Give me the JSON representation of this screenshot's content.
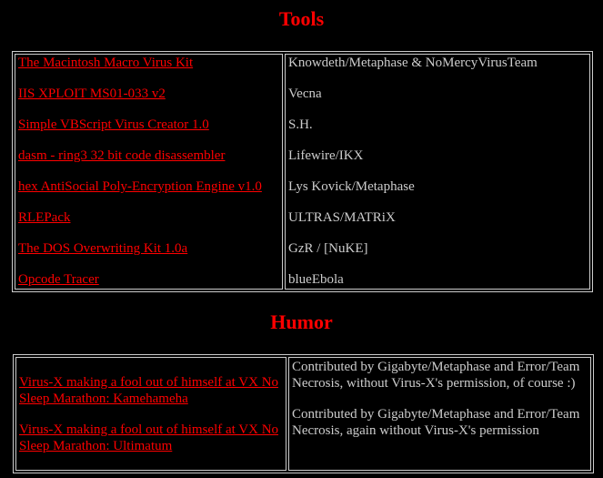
{
  "colors": {
    "background": "#000000",
    "heading": "#ff0000",
    "link": "#ff0000",
    "text": "#cccccc",
    "border": "#cccccc"
  },
  "tools": {
    "heading": "Tools",
    "rows": [
      {
        "name": "The Macintosh Macro Virus Kit",
        "author": "Knowdeth/Metaphase & NoMercyVirusTeam"
      },
      {
        "name": "IIS XPLOIT MS01-033 v2",
        "author": "Vecna"
      },
      {
        "name": "Simple VBScript Virus Creator 1.0",
        "author": "S.H."
      },
      {
        "name": "dasm - ring3 32 bit code disassembler",
        "author": "Lifewire/IKX"
      },
      {
        "name": "hex AntiSocial Poly-Encryption Engine v1.0",
        "author": "Lys Kovick/Metaphase"
      },
      {
        "name": "RLEPack",
        "author": "ULTRAS/MATRiX"
      },
      {
        "name": "The DOS Overwriting Kit 1.0a",
        "author": "GzR / [NuKE]"
      },
      {
        "name": "Opcode Tracer",
        "author": "blueEbola"
      }
    ]
  },
  "humor": {
    "heading": "Humor",
    "items": [
      {
        "title": "Virus-X making a fool out of himself at VX No Sleep Marathon: Kamehameha",
        "note": "Contributed by Gigabyte/Metaphase and Error/Team Necrosis, without Virus-X's permission, of course :)"
      },
      {
        "title": "Virus-X making a fool out of himself at VX No Sleep Marathon: Ultimatum",
        "note": "Contributed by Gigabyte/Metaphase and Error/Team Necrosis, again without Virus-X's permission"
      }
    ]
  }
}
